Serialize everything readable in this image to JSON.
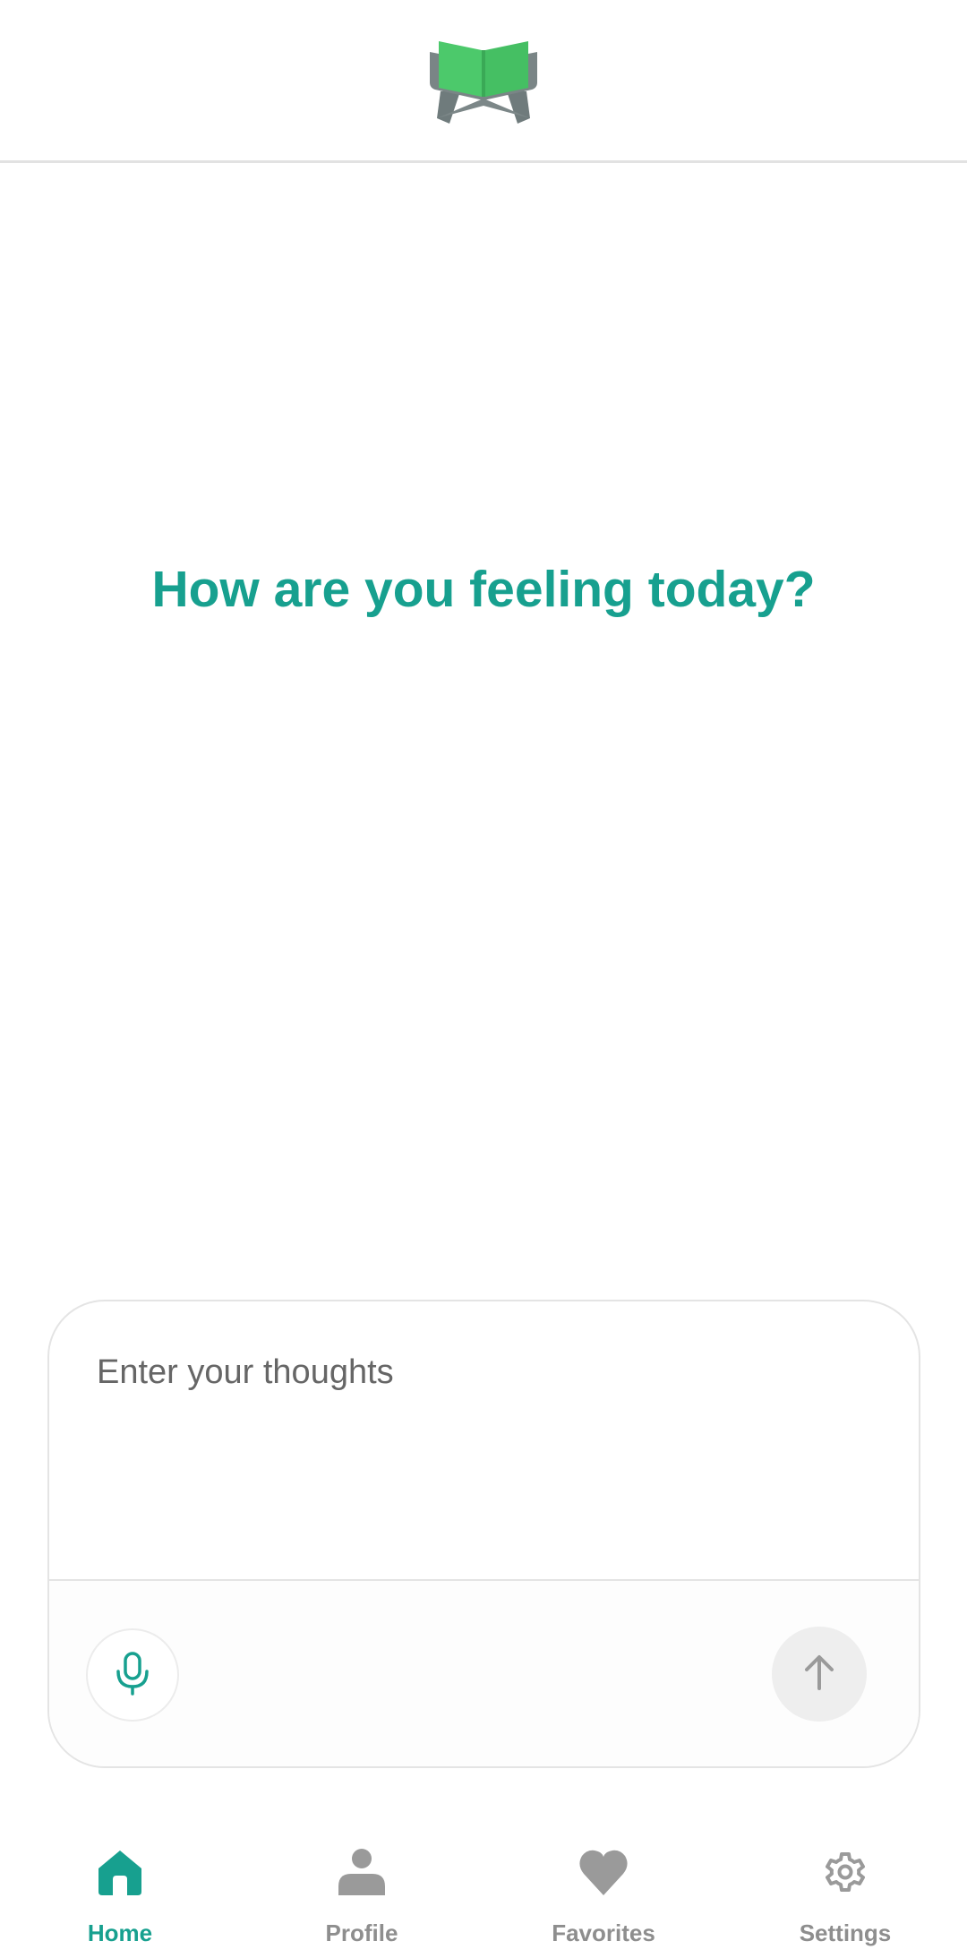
{
  "app": {
    "logo_icon": "open-book-on-stand-icon"
  },
  "main": {
    "headline": "How are you feeling today?"
  },
  "composer": {
    "placeholder": "Enter your thoughts",
    "value": "",
    "mic_icon": "microphone-icon",
    "send_icon": "arrow-up-icon"
  },
  "nav": {
    "items": [
      {
        "label": "Home",
        "icon": "home-icon",
        "active": true
      },
      {
        "label": "Profile",
        "icon": "person-icon",
        "active": false
      },
      {
        "label": "Favorites",
        "icon": "heart-icon",
        "active": false
      },
      {
        "label": "Settings",
        "icon": "gear-icon",
        "active": false
      }
    ]
  },
  "colors": {
    "accent": "#17a08f",
    "logo_green": "#4cc96b",
    "logo_gray": "#737f80",
    "inactive": "#8e8e8e"
  }
}
